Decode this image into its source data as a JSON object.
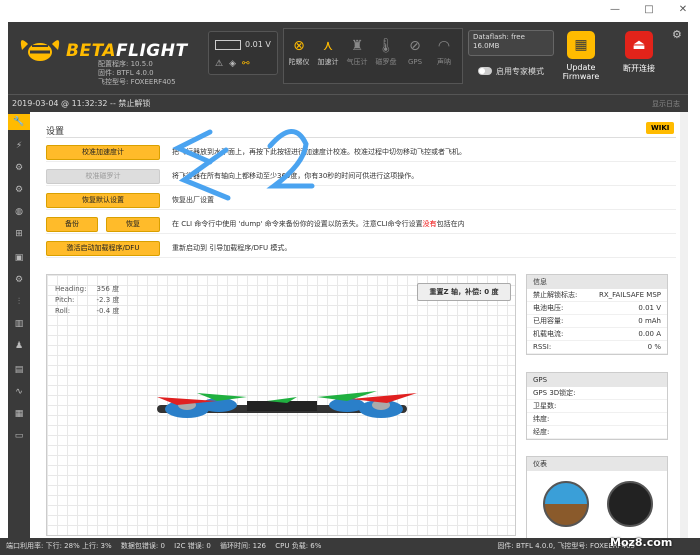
{
  "window": {
    "minimize": "—",
    "maximize": "□",
    "close": "✕"
  },
  "header": {
    "brand_prefix": "BETA",
    "brand_suffix": "FLIGHT",
    "config_version": "配置程序: 10.5.0",
    "firmware": "固件: BTFL 4.0.0",
    "board": "飞控型号: FOXEERF405",
    "battery_voltage": "0.01 V",
    "flash_title": "Dataflash: free",
    "flash_free": "16.0MB",
    "expert_mode": "启用专家模式",
    "update_firmware_1": "Update",
    "update_firmware_2": "Firmware",
    "disconnect": "断开连接",
    "sensors": [
      {
        "icon": "gyro-icon",
        "label": "陀螺仪",
        "active": true
      },
      {
        "icon": "accel-icon",
        "label": "加速计",
        "active": true
      },
      {
        "icon": "baro-icon",
        "label": "气压计",
        "active": false
      },
      {
        "icon": "mag-icon",
        "label": "磁罗盘",
        "active": false
      },
      {
        "icon": "gps-icon",
        "label": "GPS",
        "active": false
      },
      {
        "icon": "sonar-icon",
        "label": "声呐",
        "active": false
      }
    ]
  },
  "statusline": {
    "text": "2019-03-04 @ 11:32:32 -- 禁止解锁",
    "show_log": "显示日志"
  },
  "main": {
    "title": "设置",
    "wiki": "WIKI",
    "actions": [
      {
        "button": "校准加速度计",
        "desc": "把飞行器放到水平面上，再按下此按钮进行加速度计校准。校准过程中切勿移动飞控或者飞机。"
      },
      {
        "button": "校准磁罗计",
        "desc": "将飞行器在所有轴向上都移动至少360度，你有30秒的时间可供进行这项操作。"
      },
      {
        "button": "恢复默认设置",
        "desc": "恢复出厂设置"
      },
      {
        "button_a": "备份",
        "button_b": "恢复",
        "desc_a": "在 CLI 命令行中使用 'dump' 命令来备份你的设置以防丢失。注意CLI命令行设置",
        "desc_red": "没有",
        "desc_b": "包括在内"
      },
      {
        "button": "激活启动加载程序/DFU",
        "desc": "重新启动到 引导加载程序/DFU 模式。"
      }
    ],
    "attitude": {
      "heading_label": "Heading:",
      "heading": "356 度",
      "pitch_label": "Pitch:",
      "pitch": "-2.3 度",
      "roll_label": "Roll:",
      "roll": "-0.4 度"
    },
    "reset_z": "重置Z 轴，补偿: 0 度"
  },
  "info": {
    "title": "信息",
    "rows": [
      {
        "label": "禁止解锁标志:",
        "value": "RX_FAILSAFE MSP"
      },
      {
        "label": "电池电压:",
        "value": "0.01 V"
      },
      {
        "label": "已用容量:",
        "value": "0 mAh"
      },
      {
        "label": "机载电流:",
        "value": "0.00 A"
      },
      {
        "label": "RSSI:",
        "value": "0 %"
      }
    ]
  },
  "gps": {
    "title": "GPS",
    "rows": [
      {
        "label": "GPS 3D锁定:",
        "value": ""
      },
      {
        "label": "卫星数:",
        "value": ""
      },
      {
        "label": "纬度:",
        "value": ""
      },
      {
        "label": "经度:",
        "value": ""
      }
    ]
  },
  "instruments": {
    "title": "仪表"
  },
  "footer": {
    "port_usage": "端口利用率: 下行: 28% 上行: 3%",
    "packet_error": "数据包错误: 0",
    "i2c_error": "I2C 错误: 0",
    "cycle_time": "循环时间: 126",
    "cpu_load": "CPU 负载: 6%",
    "firmware": "固件: BTFL 4.0.0, 飞控型号: FOXEERF405",
    "watermark": "Moz8.com"
  },
  "colors": {
    "accent": "#ffbb00",
    "header_bg": "#3a3a3a",
    "update_btn": "#ffbb00",
    "disconnect_btn": "#e2231a",
    "annotation": "#4aa3f0"
  }
}
